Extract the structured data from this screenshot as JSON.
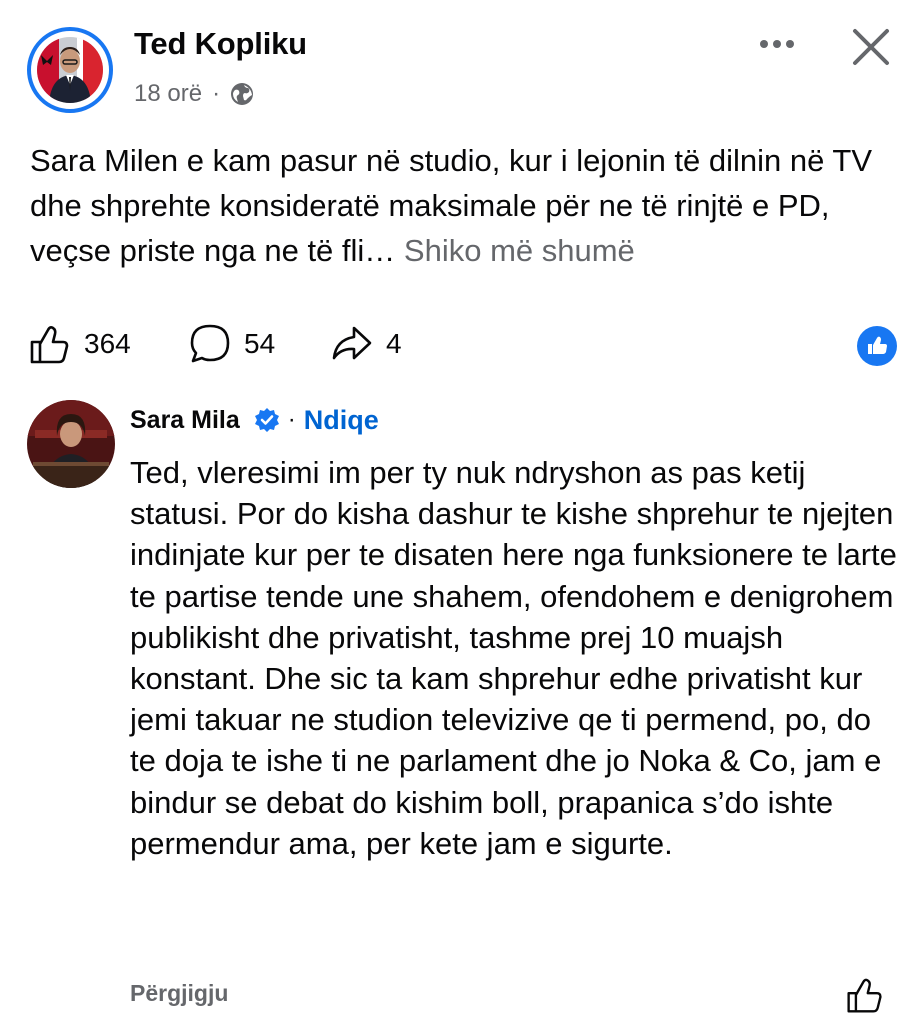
{
  "post": {
    "author": "Ted Kopliku",
    "time": "18 orë",
    "separator": "·",
    "privacy_icon": "globe-icon",
    "text": "Sara Milen e kam pasur në studio, kur i lejonin të dilnin në TV dhe shprehte konsideratë maksimale për ne të rinjtë e PD, veçse priste nga ne të fli…",
    "see_more": "Shiko më shumë"
  },
  "reactions": {
    "likes": "364",
    "comments": "54",
    "shares": "4"
  },
  "comment": {
    "author": "Sara Mila",
    "separator": "·",
    "follow_label": "Ndiqe",
    "text": "Ted, vleresimi im per ty nuk ndryshon as pas ketij statusi. Por do kisha dashur te kishe shprehur te njejten indinjate kur per te disaten here nga funksionere te larte te partise tende une shahem, ofendohem e denigrohem publikisht dhe privatisht, tashme prej 10 muajsh konstant. Dhe sic ta kam shprehur edhe privatisht kur jemi takuar ne studion televizive qe ti permend, po, do te doja te ishe ti ne parlament dhe jo Noka & Co, jam e bindur se debat do kishim boll, prapanica s’do ishte permendur ama, per kete jam e sigurte.",
    "reply_label": "Përgjigju"
  },
  "colors": {
    "accent": "#1877f2",
    "follow_link": "#0064d1",
    "secondary_text": "#65676b"
  }
}
